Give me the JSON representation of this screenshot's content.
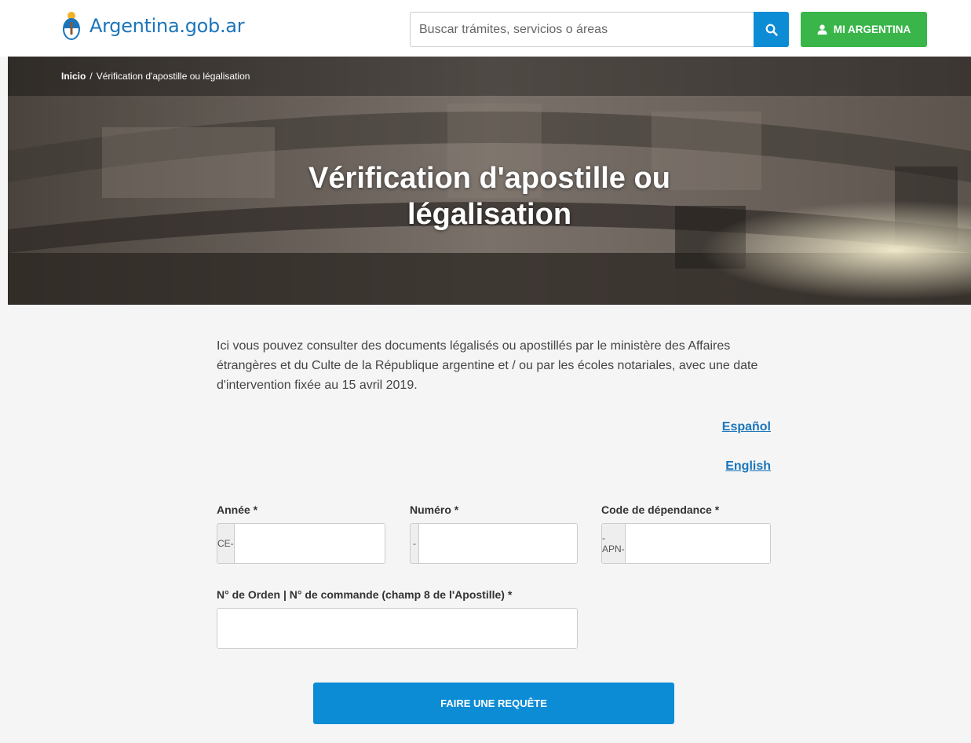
{
  "header": {
    "logo_text": "Argentina.gob.ar",
    "search_placeholder": "Buscar trámites, servicios o áreas",
    "search_icon": "search-icon",
    "account_button": "MI ARGENTINA",
    "account_icon": "user-icon"
  },
  "hero": {
    "breadcrumb_home": "Inicio",
    "breadcrumb_separator": "/",
    "breadcrumb_current": "Vérification d'apostille ou légalisation",
    "title_line1": "Vérification d'apostille ou",
    "title_line2": "légalisation"
  },
  "main": {
    "intro": "Ici vous pouvez consulter des documents légalisés ou apostillés par le ministère des Affaires étrangères et du Culte de la République argentine et / ou par les écoles notariales, avec une date d'intervention fixée au 15 avril 2019.",
    "lang_es": "Español",
    "lang_en": "English"
  },
  "form": {
    "year_label": "Année *",
    "year_prefix": "CE-",
    "year_value": "",
    "number_label": "Numéro *",
    "number_prefix": "-",
    "number_value": "",
    "dependency_label": "Code de dépendance *",
    "dependency_prefix": "-APN-",
    "dependency_value": "",
    "order_label": "N° de Orden | N° de commande (champ 8 de l'Apostille) *",
    "order_value": "",
    "submit_label": "FAIRE UNE REQUÊTE"
  },
  "colors": {
    "brand_blue": "#1b75bb",
    "action_blue": "#0d8cd6",
    "account_green": "#39b54a",
    "page_bg": "#f5f5f5"
  }
}
